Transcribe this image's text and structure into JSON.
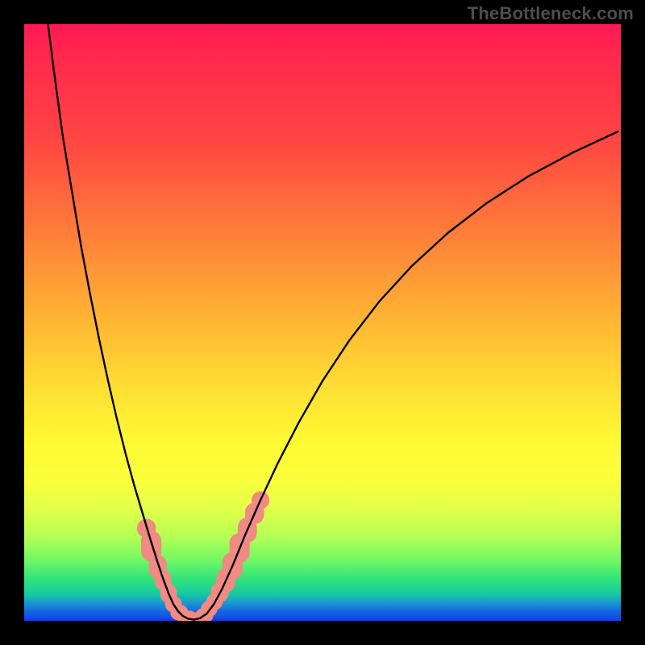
{
  "watermark_text": "TheBottleneck.com",
  "chart_data": {
    "type": "line",
    "title": "",
    "xlabel": "",
    "ylabel": "",
    "xlim": [
      0,
      100
    ],
    "ylim": [
      0,
      100
    ],
    "grid": false,
    "series": [
      {
        "name": "curve",
        "color": "#000000",
        "x": [
          4.0,
          5.0,
          6.5,
          8.0,
          9.5,
          11.0,
          12.5,
          14.0,
          15.5,
          17.0,
          18.5,
          20.0,
          21.2,
          22.3,
          23.3,
          24.2,
          25.0,
          25.8,
          26.6,
          27.5,
          28.5,
          29.5,
          30.6,
          31.8,
          33.2,
          35.0,
          37.0,
          39.5,
          42.5,
          46.0,
          50.0,
          54.5,
          59.5,
          65.0,
          71.0,
          77.5,
          84.5,
          92.0,
          99.5
        ],
        "y": [
          100.0,
          92.0,
          81.0,
          72.0,
          63.0,
          55.0,
          47.5,
          40.5,
          34.0,
          28.0,
          22.5,
          17.5,
          13.5,
          10.0,
          7.0,
          4.6,
          2.8,
          1.6,
          0.8,
          0.35,
          0.2,
          0.45,
          1.2,
          2.8,
          5.4,
          9.4,
          14.3,
          20.0,
          26.4,
          33.2,
          40.2,
          47.0,
          53.5,
          59.5,
          65.0,
          70.0,
          74.5,
          78.5,
          82.0
        ]
      }
    ],
    "marker_clusters": [
      {
        "name": "left-cluster",
        "shape": "rounded-blob",
        "color": "#f08a82",
        "points": [
          {
            "x": 20.5,
            "y": 15.5,
            "w": 3.2,
            "h": 3.2
          },
          {
            "x": 21.3,
            "y": 12.5,
            "w": 3.4,
            "h": 5.2
          },
          {
            "x": 22.4,
            "y": 9.0,
            "w": 3.0,
            "h": 4.0
          },
          {
            "x": 23.3,
            "y": 6.8,
            "w": 2.8,
            "h": 3.4
          },
          {
            "x": 24.2,
            "y": 4.6,
            "w": 2.8,
            "h": 3.2
          },
          {
            "x": 25.0,
            "y": 2.8,
            "w": 2.8,
            "h": 2.8
          },
          {
            "x": 26.0,
            "y": 1.4,
            "w": 3.0,
            "h": 2.6
          },
          {
            "x": 27.3,
            "y": 0.5,
            "w": 3.4,
            "h": 2.4
          },
          {
            "x": 28.8,
            "y": 0.25,
            "w": 3.6,
            "h": 2.3
          },
          {
            "x": 30.2,
            "y": 0.9,
            "w": 3.0,
            "h": 2.4
          }
        ]
      },
      {
        "name": "right-cluster",
        "shape": "rounded-blob",
        "color": "#f08a82",
        "points": [
          {
            "x": 31.0,
            "y": 2.0,
            "w": 2.8,
            "h": 2.6
          },
          {
            "x": 31.9,
            "y": 3.2,
            "w": 2.8,
            "h": 2.8
          },
          {
            "x": 32.8,
            "y": 4.8,
            "w": 3.0,
            "h": 3.4
          },
          {
            "x": 33.8,
            "y": 6.8,
            "w": 3.2,
            "h": 4.0
          },
          {
            "x": 34.9,
            "y": 9.2,
            "w": 3.4,
            "h": 4.6
          },
          {
            "x": 36.1,
            "y": 12.2,
            "w": 3.4,
            "h": 5.0
          },
          {
            "x": 37.4,
            "y": 15.2,
            "w": 3.2,
            "h": 4.2
          },
          {
            "x": 38.6,
            "y": 18.0,
            "w": 3.2,
            "h": 3.6
          },
          {
            "x": 39.6,
            "y": 20.2,
            "w": 3.0,
            "h": 3.0
          }
        ]
      }
    ]
  }
}
